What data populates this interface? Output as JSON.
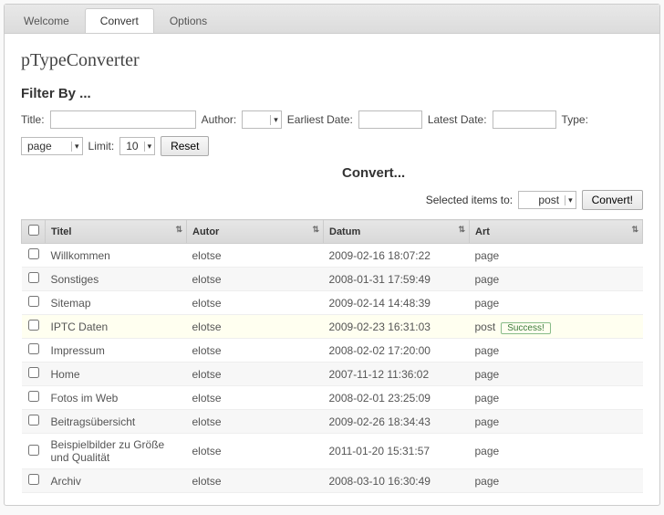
{
  "tabs": [
    "Welcome",
    "Convert",
    "Options"
  ],
  "activeTab": 1,
  "title": "pTypeConverter",
  "filterHeading": "Filter By ...",
  "filters": {
    "titleLabel": "Title:",
    "titleValue": "",
    "authorLabel": "Author:",
    "authorValue": "",
    "earliestLabel": "Earliest Date:",
    "earliestValue": "",
    "latestLabel": "Latest Date:",
    "latestValue": "",
    "typeLabel": "Type:",
    "typeValue": "page",
    "limitLabel": "Limit:",
    "limitValue": "10",
    "resetLabel": "Reset"
  },
  "convert": {
    "heading": "Convert...",
    "toLabel": "Selected items to:",
    "toValue": "post",
    "buttonLabel": "Convert!"
  },
  "columns": {
    "titel": "Titel",
    "autor": "Autor",
    "datum": "Datum",
    "art": "Art"
  },
  "rows": [
    {
      "titel": "Willkommen",
      "autor": "elotse",
      "datum": "2009-02-16 18:07:22",
      "art": "page",
      "success": false,
      "hl": false
    },
    {
      "titel": "Sonstiges",
      "autor": "elotse",
      "datum": "2008-01-31 17:59:49",
      "art": "page",
      "success": false,
      "hl": false
    },
    {
      "titel": "Sitemap",
      "autor": "elotse",
      "datum": "2009-02-14 14:48:39",
      "art": "page",
      "success": false,
      "hl": false
    },
    {
      "titel": "IPTC Daten",
      "autor": "elotse",
      "datum": "2009-02-23 16:31:03",
      "art": "post",
      "success": true,
      "hl": true
    },
    {
      "titel": "Impressum",
      "autor": "elotse",
      "datum": "2008-02-02 17:20:00",
      "art": "page",
      "success": false,
      "hl": false
    },
    {
      "titel": "Home",
      "autor": "elotse",
      "datum": "2007-11-12 11:36:02",
      "art": "page",
      "success": false,
      "hl": false
    },
    {
      "titel": "Fotos im Web",
      "autor": "elotse",
      "datum": "2008-02-01 23:25:09",
      "art": "page",
      "success": false,
      "hl": false
    },
    {
      "titel": "Beitragsübersicht",
      "autor": "elotse",
      "datum": "2009-02-26 18:34:43",
      "art": "page",
      "success": false,
      "hl": false
    },
    {
      "titel": "Beispielbilder zu Größe und Qualität",
      "autor": "elotse",
      "datum": "2011-01-20 15:31:57",
      "art": "page",
      "success": false,
      "hl": false
    },
    {
      "titel": "Archiv",
      "autor": "elotse",
      "datum": "2008-03-10 16:30:49",
      "art": "page",
      "success": false,
      "hl": false
    }
  ],
  "successLabel": "Success!"
}
